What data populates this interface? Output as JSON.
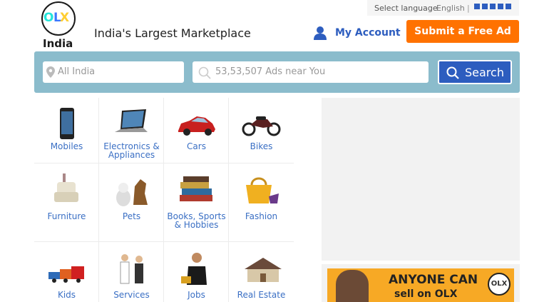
{
  "header": {
    "logo_letters": [
      "O",
      "L",
      "X"
    ],
    "logo_country": "India",
    "tagline": "India's Largest Marketplace",
    "language_label": "Select language",
    "language_value": "English",
    "language_sep": "|",
    "account_label": "My Account",
    "submit_label": "Submit a Free Ad"
  },
  "search": {
    "location_placeholder": "All India",
    "query_placeholder": "53,53,507 Ads near You",
    "button_label": "Search"
  },
  "categories": [
    {
      "label": "Mobiles",
      "icon": "mobile-phone-icon"
    },
    {
      "label": "Electronics & Appliances",
      "icon": "laptop-icon"
    },
    {
      "label": "Cars",
      "icon": "car-icon"
    },
    {
      "label": "Bikes",
      "icon": "motorbike-icon"
    },
    {
      "label": "Furniture",
      "icon": "chair-icon"
    },
    {
      "label": "Pets",
      "icon": "pets-icon"
    },
    {
      "label": "Books, Sports & Hobbies",
      "icon": "books-icon"
    },
    {
      "label": "Fashion",
      "icon": "handbag-icon"
    },
    {
      "label": "Kids",
      "icon": "toy-train-icon"
    },
    {
      "label": "Services",
      "icon": "workers-icon"
    },
    {
      "label": "Jobs",
      "icon": "businessman-icon"
    },
    {
      "label": "Real Estate",
      "icon": "house-icon"
    }
  ],
  "ad": {
    "line1": "ANYONE CAN",
    "line2": "sell on OLX",
    "logo": "OLX"
  },
  "colors": {
    "brand_blue": "#2d5dbf",
    "submit_orange": "#ff7200",
    "search_bar": "#8bbccc",
    "link_blue": "#3a6fc4"
  }
}
